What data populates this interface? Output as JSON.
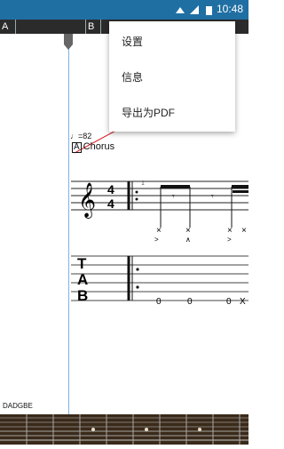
{
  "status_bar": {
    "time": "10:48"
  },
  "timeline": {
    "sections": [
      "A",
      "B"
    ]
  },
  "menu": {
    "items": [
      "设置",
      "信息",
      "导出为PDF"
    ]
  },
  "score": {
    "tempo": "♩=82",
    "section_marker": "A",
    "section_name": "Chorus",
    "measure_number": "1",
    "time_signature": {
      "numerator": "4",
      "denominator": "4"
    },
    "tab_clef": [
      "T",
      "A",
      "B"
    ],
    "tab_frets": [
      "0",
      "0",
      "0",
      "X"
    ],
    "tuning": "DADGBE"
  },
  "colors": {
    "status_bar": "#1f6fa3",
    "annotation_arrow": "#d9262b",
    "cursor_line": "#7fb2e5"
  }
}
